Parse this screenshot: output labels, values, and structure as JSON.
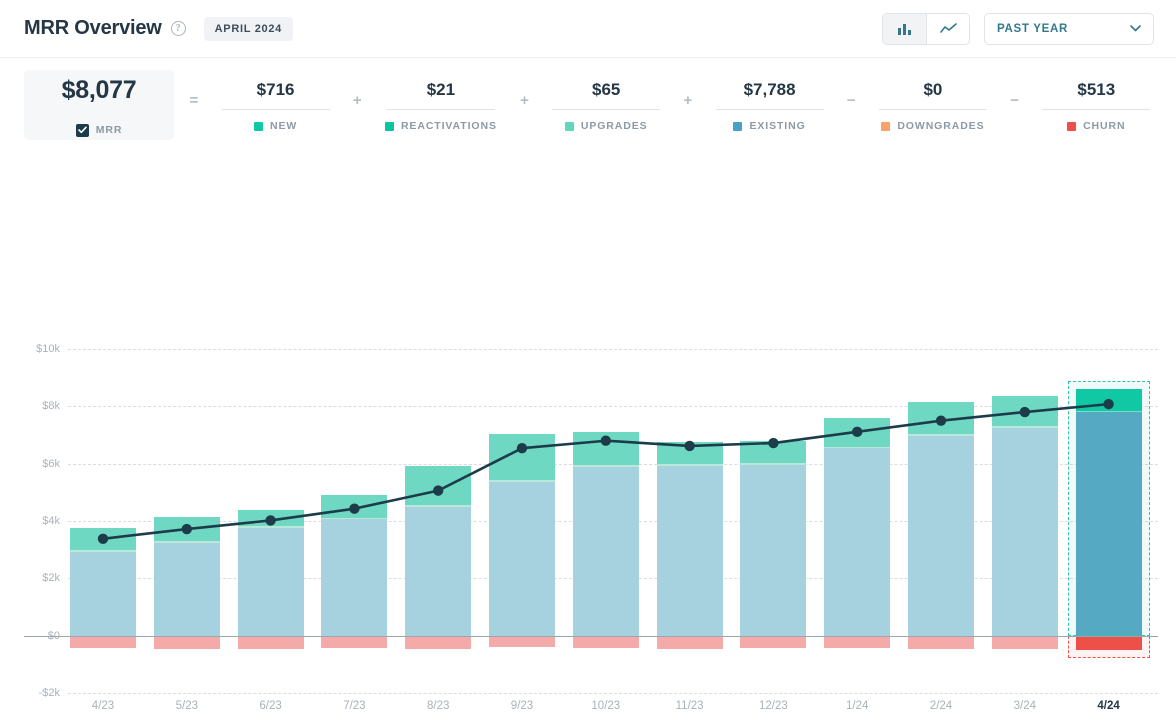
{
  "header": {
    "title": "MRR Overview",
    "help_icon": "question-circle-icon",
    "period_badge": "APRIL 2024",
    "view_toggle": [
      {
        "icon": "bar-chart-icon",
        "active": true
      },
      {
        "icon": "line-chart-icon",
        "active": false
      }
    ],
    "range_dropdown": {
      "label": "PAST YEAR",
      "icon": "chevron-down-icon"
    }
  },
  "kpis": [
    {
      "value": "$8,077",
      "label": "MRR",
      "color": "#1d3c4a",
      "primary": true,
      "checkbox": true,
      "op_before": ""
    },
    {
      "value": "$716",
      "label": "NEW",
      "color": "#0ec9a4",
      "primary": false,
      "checkbox": false,
      "op_before": "="
    },
    {
      "value": "$21",
      "label": "REACTIVATIONS",
      "color": "#06c6a2",
      "primary": false,
      "checkbox": false,
      "op_before": "+"
    },
    {
      "value": "$65",
      "label": "UPGRADES",
      "color": "#5fd8b8",
      "primary": false,
      "checkbox": false,
      "op_before": "+"
    },
    {
      "value": "$7,788",
      "label": "EXISTING",
      "color": "#4a9fc7",
      "primary": false,
      "checkbox": false,
      "op_before": "+"
    },
    {
      "value": "$0",
      "label": "DOWNGRADES",
      "color": "#fba06a",
      "primary": false,
      "checkbox": false,
      "op_before": "−"
    },
    {
      "value": "$513",
      "label": "CHURN",
      "color": "#ee4f4a",
      "primary": false,
      "checkbox": false,
      "op_before": "−"
    }
  ],
  "chart_data": {
    "type": "bar",
    "title": "MRR Overview",
    "xlabel": "",
    "ylabel": "",
    "ylim": [
      -2000,
      10000
    ],
    "grid": true,
    "legend_position": "top",
    "stacked": true,
    "categories": [
      "4/23",
      "5/23",
      "6/23",
      "7/23",
      "8/23",
      "9/23",
      "10/23",
      "11/23",
      "12/23",
      "1/24",
      "2/24",
      "3/24",
      "4/24"
    ],
    "ytick_labels": [
      "$10k",
      "$8k",
      "$6k",
      "$4k",
      "$2k",
      "$0",
      "-$2k"
    ],
    "ytick_values": [
      10000,
      8000,
      6000,
      4000,
      2000,
      0,
      -2000
    ],
    "selected_category": "4/24",
    "series": [
      {
        "name": "Existing",
        "color": "#a6d2e0",
        "selected_color": "#5aa7c4",
        "values": [
          2920,
          3230,
          3760,
          4060,
          4500,
          5360,
          5900,
          5920,
          5960,
          6530,
          6970,
          7260,
          7788
        ]
      },
      {
        "name": "Upgrades",
        "color": "#b9e8da",
        "selected_color": "#7fe0c6",
        "values": [
          60,
          60,
          60,
          60,
          60,
          80,
          65,
          60,
          60,
          65,
          65,
          65,
          65
        ]
      },
      {
        "name": "New + Reactivations",
        "color": "#6fd8c3",
        "selected_color": "#0ec9a4",
        "values": [
          760,
          840,
          550,
          780,
          1360,
          1590,
          1140,
          770,
          780,
          1000,
          1110,
          1030,
          737
        ]
      },
      {
        "name": "Churn",
        "color": "#f4aaa8",
        "selected_color": "#ee4f4a",
        "values": [
          -430,
          -470,
          -470,
          -430,
          -470,
          -390,
          -420,
          -450,
          -420,
          -440,
          -470,
          -450,
          -513
        ]
      }
    ],
    "line_series": {
      "name": "MRR",
      "color": "#1d3c4a",
      "marker_color": "#1d3c4a",
      "values": [
        3380,
        3720,
        4020,
        4430,
        5060,
        6540,
        6800,
        6620,
        6720,
        7110,
        7500,
        7800,
        8077
      ]
    }
  }
}
